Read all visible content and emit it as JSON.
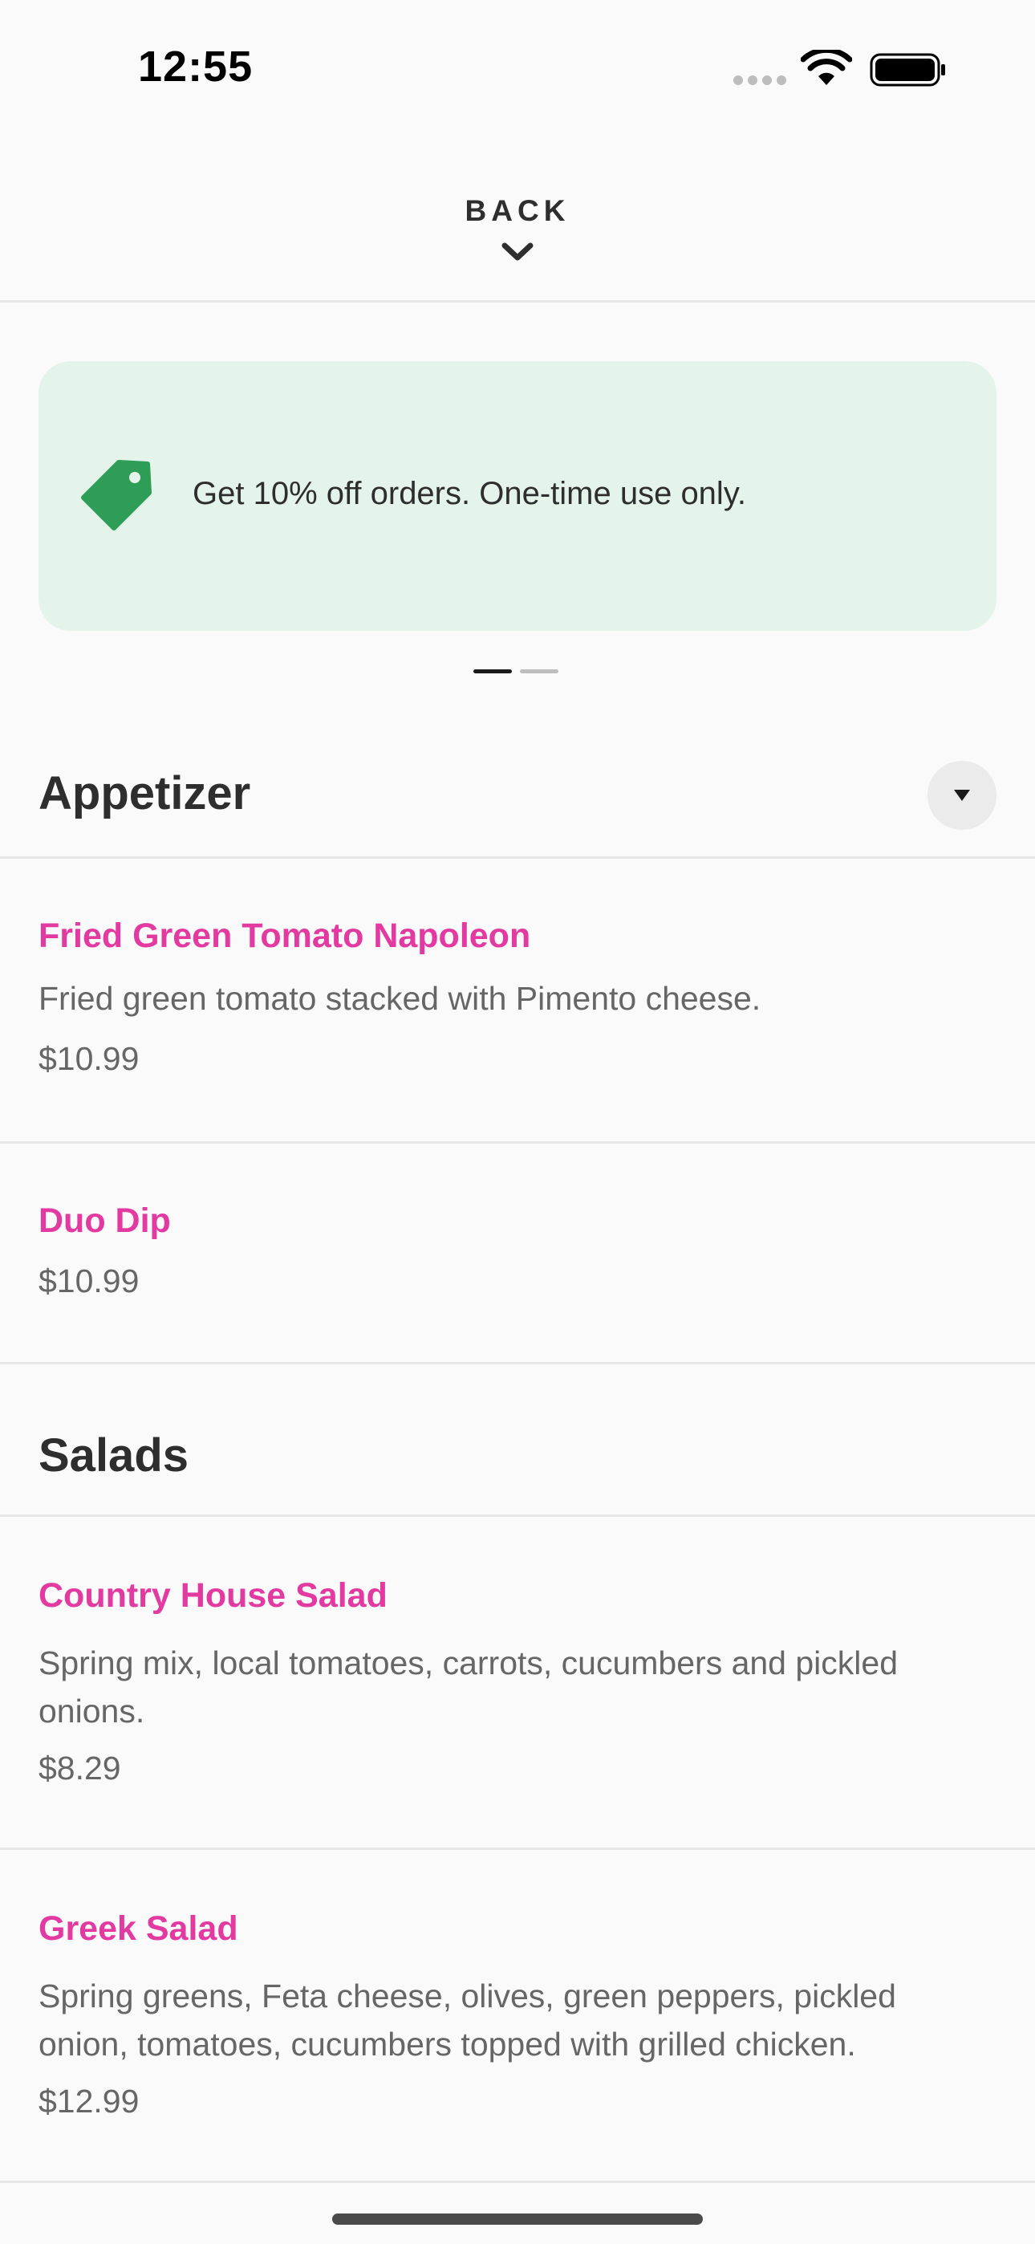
{
  "status_bar": {
    "time": "12:55"
  },
  "nav": {
    "back_label": "BACK"
  },
  "promo": {
    "text": "Get 10% off orders. One-time use only.",
    "accent_color": "#2e9e57",
    "pages": 2,
    "active_page": 1
  },
  "sections": [
    {
      "title": "Appetizer",
      "items": [
        {
          "name": "Fried Green Tomato Napoleon",
          "description": "Fried green tomato stacked with Pimento cheese.",
          "price": "$10.99"
        },
        {
          "name": "Duo Dip",
          "description": "",
          "price": "$10.99"
        }
      ]
    },
    {
      "title": "Salads",
      "items": [
        {
          "name": "Country House Salad",
          "description": "Spring mix, local tomatoes, carrots, cucumbers and pickled onions.",
          "price": "$8.29"
        },
        {
          "name": "Greek Salad",
          "description": "Spring greens, Feta cheese, olives, green peppers, pickled onion, tomatoes, cucumbers topped with grilled chicken.",
          "price": "$12.99"
        }
      ]
    }
  ],
  "colors": {
    "item_name": "#e23aa0",
    "promo_background": "#e4f4eb"
  }
}
